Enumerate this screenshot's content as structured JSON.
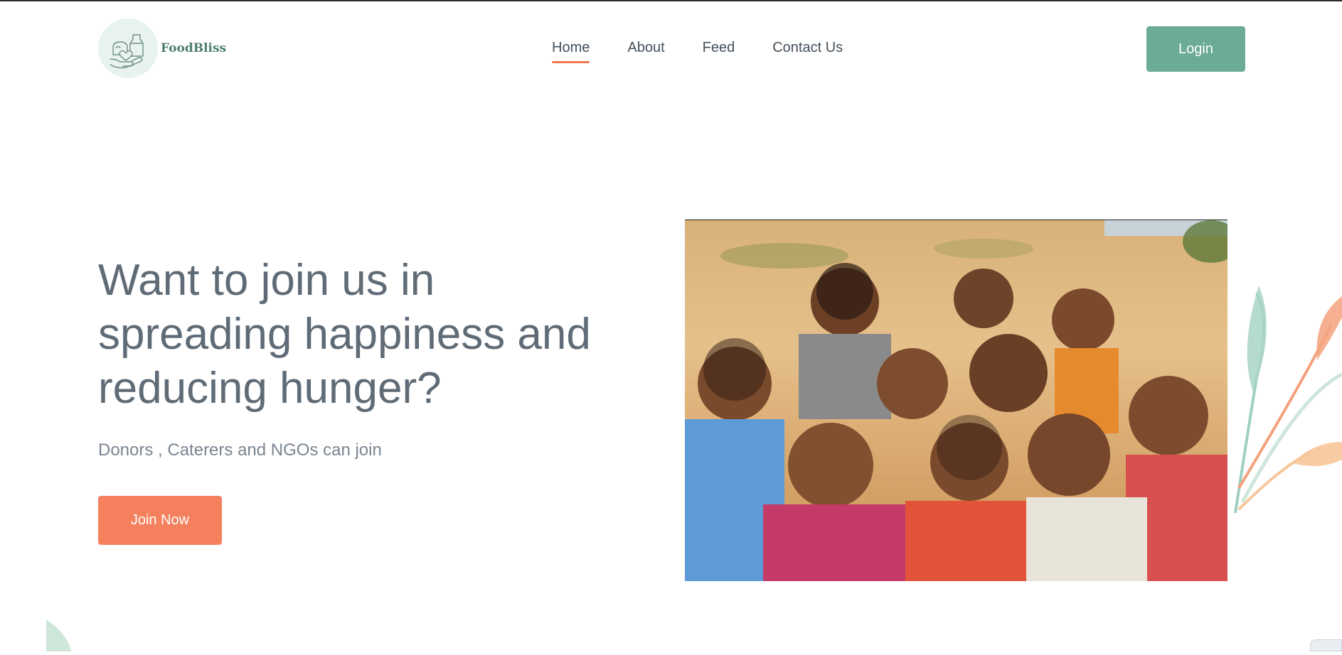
{
  "brand": {
    "name": "FoodBliss",
    "logo_icon": "hand-holding-food-icon"
  },
  "nav": {
    "items": [
      {
        "label": "Home",
        "active": true
      },
      {
        "label": "About",
        "active": false
      },
      {
        "label": "Feed",
        "active": false
      },
      {
        "label": "Contact Us",
        "active": false
      }
    ]
  },
  "header": {
    "login_label": "Login"
  },
  "hero": {
    "title": "Want to join us in spreading happiness and reducing hunger?",
    "subtitle": "Donors , Caterers and NGOs can join",
    "cta_label": "Join Now"
  },
  "colors": {
    "accent_green": "#6bab98",
    "accent_orange": "#f4805e",
    "heading_gray": "#5f6b76",
    "nav_underline": "#f07850"
  }
}
